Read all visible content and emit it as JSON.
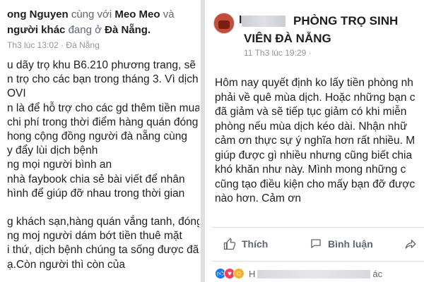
{
  "left_post": {
    "author_fragment": "ong Nguyen",
    "with_text": "cùng với",
    "tagged_friend": "Meo Meo",
    "and_text": "và",
    "others_text": "người khác",
    "at_text": "đang ở",
    "location": "Đà Nẵng.",
    "timestamp": "Th3 lúc 13:02",
    "place": "Đà Nẵng",
    "body_lines": [
      "u dãy trọ khu B6.210 phương trang, sẽ",
      "n trọ cho các bạn trong tháng 3. Vì dịch",
      "OVI",
      "n là để hỗ trợ cho các gd thêm tiền mua",
      "chi phí trong thời điểm hàng quán đóng",
      "hong cộng đồng người đà nẵng cùng",
      "y đẩy lùi dịch bệnh",
      "ng mọi người bình an",
      "nhà faybook chia sẻ bài viết để nhân",
      "hình để giúp đỡ nhau trong thời gian",
      "",
      "g khách sạn,hàng quán vắng tanh, đóng",
      "ng moj người dám bớt tiền thuê mặt",
      "i thứ, dịch bệnh chúng ta sống được đã",
      "ạ.Còn người thì còn của"
    ]
  },
  "right_post": {
    "author_initial": "I",
    "page_name_line1": "PHÒNG TRỌ SINH",
    "page_name_line2": "VIÊN ĐÀ NẴNG",
    "timestamp": "11 Th3 lúc 19:29",
    "body_lines": [
      "Hôm nay quyết định ko lấy tiền phòng nh",
      "phải về quê mùa dịch. Hoặc những bạn c",
      "đã giảm và sẽ tiếp tục giảm có khi miễn",
      "phòng nếu mùa dịch kéo dài.  Nhận nhữ",
      "cảm ơn thực sự ý nghĩa hơn rất nhiều.  M",
      "giúp được gì nhiều nhưng cũng biết chia",
      "khó khăn như này.  Mình mong những c",
      "cũng tạo điều kiện cho mấy bạn đỡ được",
      "nào hơn.  Cảm ơn"
    ],
    "actions": {
      "like": "Thích",
      "comment": "Bình luận"
    },
    "reactions_start": "H",
    "reactions_end": "ác"
  },
  "colors": {
    "link_blue": "#1877f2",
    "meta_gray": "#90949c",
    "divider": "#dadde1"
  }
}
